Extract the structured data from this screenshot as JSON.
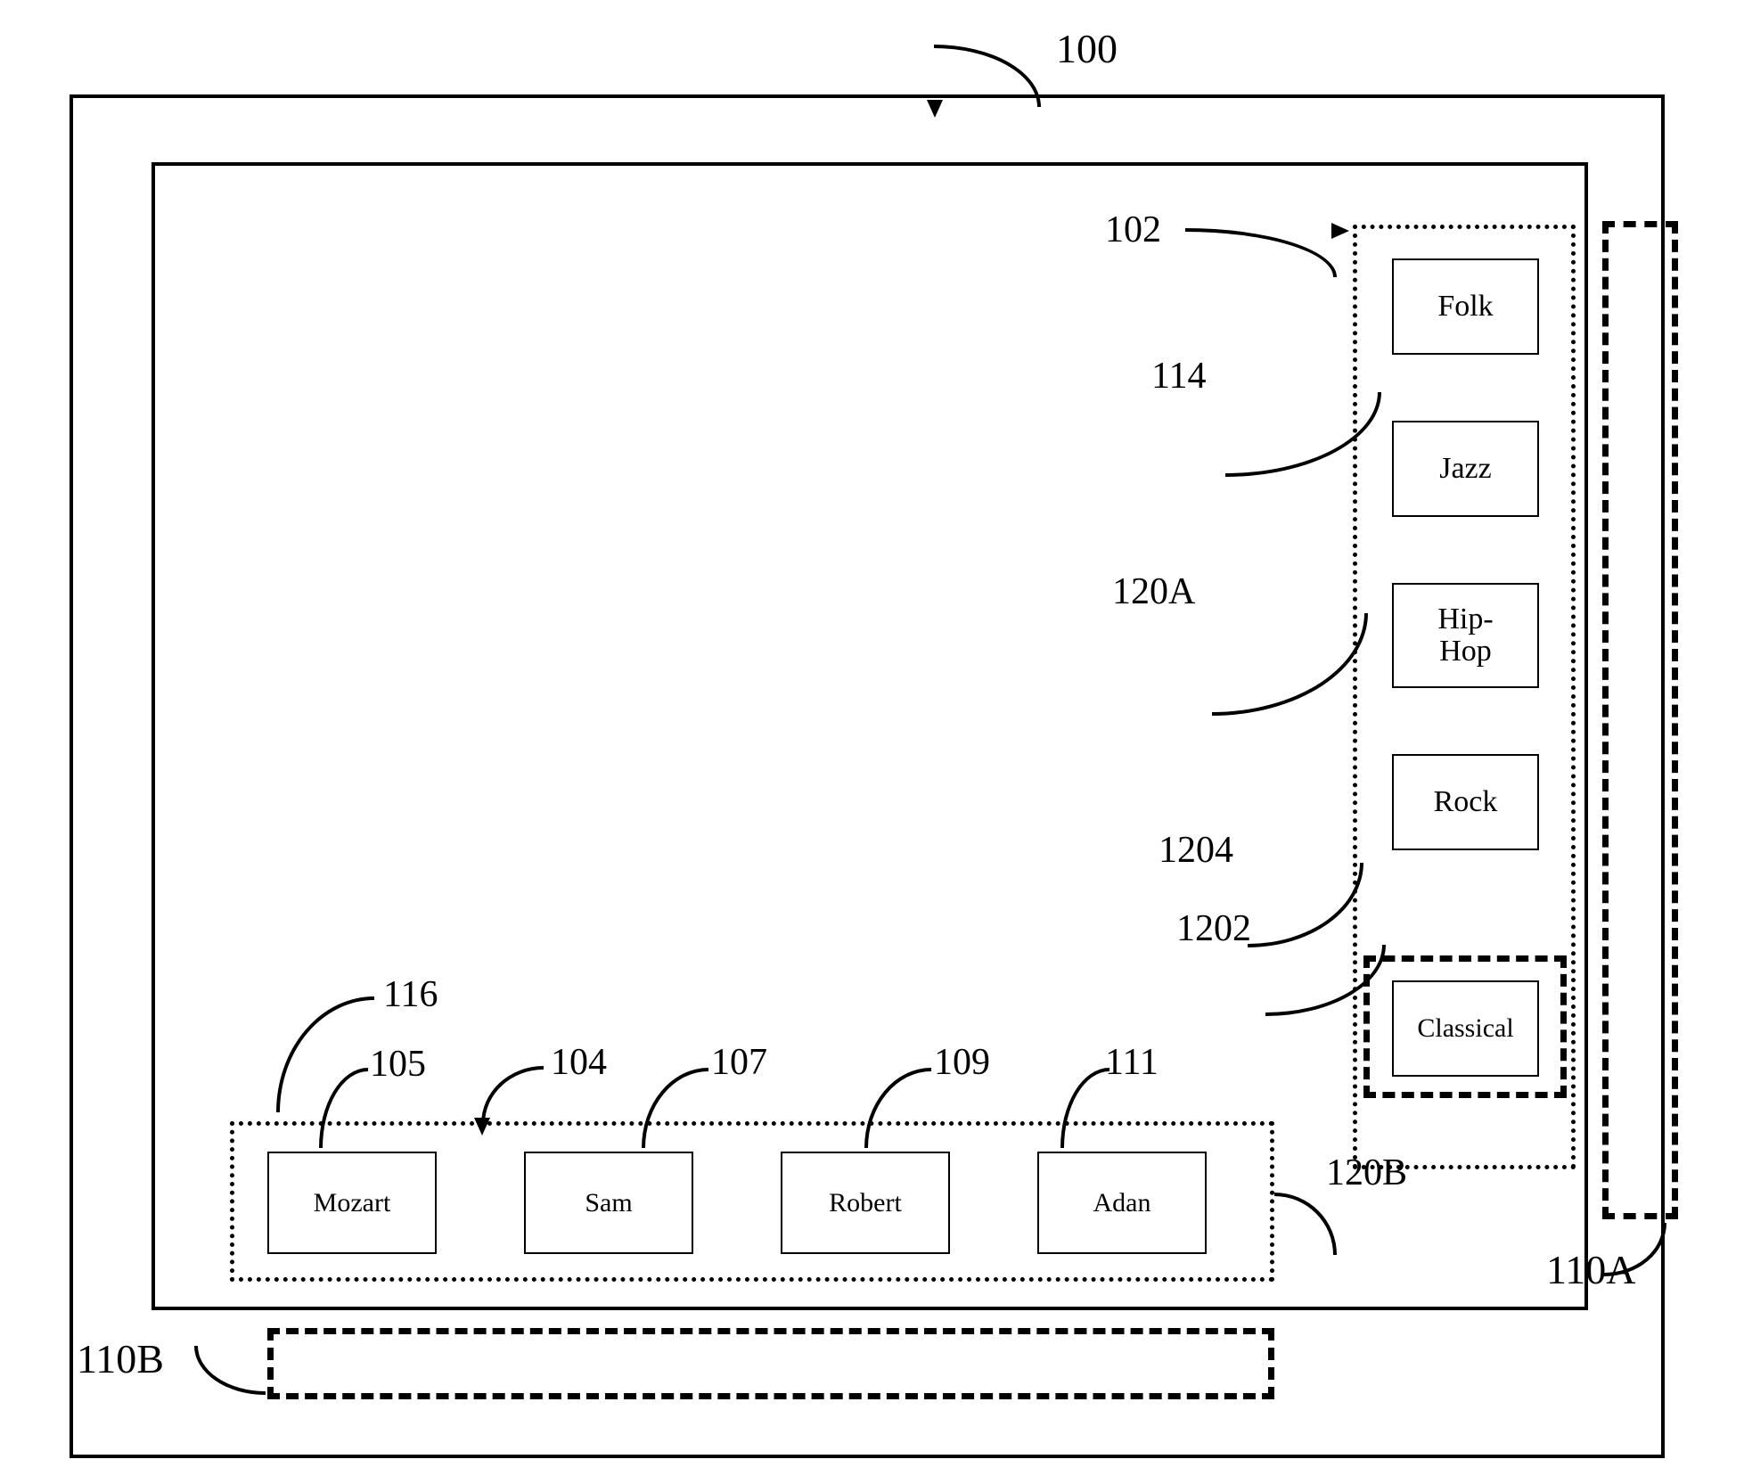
{
  "labels": {
    "l100": "100",
    "l102": "102",
    "l114": "114",
    "l120A": "120A",
    "l1204": "1204",
    "l1202": "1202",
    "l116": "116",
    "l105": "105",
    "l104": "104",
    "l107": "107",
    "l109": "109",
    "l111": "111",
    "l120B": "120B",
    "l110A": "110A",
    "l110B": "110B"
  },
  "genres": {
    "folk": "Folk",
    "jazz": "Jazz",
    "hiphop": "Hip-\nHop",
    "rock": "Rock",
    "classical": "Classical"
  },
  "artists": {
    "a0": "Mozart",
    "a1": "Sam",
    "a2": "Robert",
    "a3": "Adan"
  }
}
